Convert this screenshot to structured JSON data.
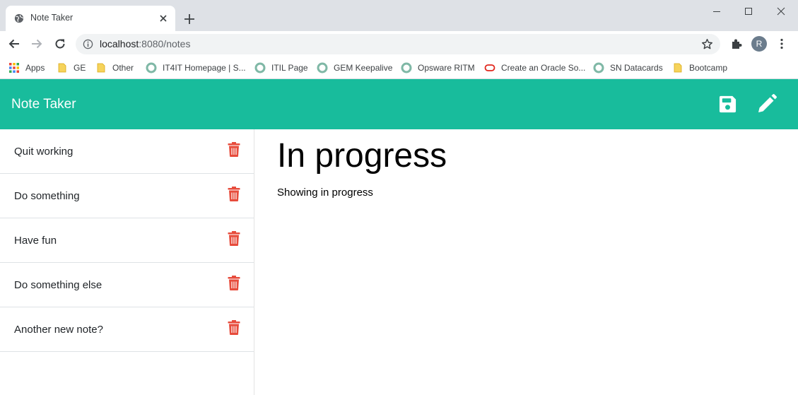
{
  "browser": {
    "tab_title": "Note Taker",
    "url_host": "localhost",
    "url_path": ":8080/notes",
    "profile_initial": "R",
    "bookmarks": [
      {
        "label": "Apps",
        "icon": "apps-grid-icon"
      },
      {
        "label": "GE",
        "icon": "folder-icon"
      },
      {
        "label": "Other",
        "icon": "folder-icon"
      },
      {
        "label": "IT4IT Homepage | S...",
        "icon": "site-icon"
      },
      {
        "label": "ITIL Page",
        "icon": "site-icon"
      },
      {
        "label": "GEM Keepalive",
        "icon": "site-icon"
      },
      {
        "label": "Opsware RITM",
        "icon": "site-icon"
      },
      {
        "label": "Create an Oracle So...",
        "icon": "oracle-icon"
      },
      {
        "label": "SN Datacards",
        "icon": "site-icon"
      },
      {
        "label": "Bootcamp",
        "icon": "folder-icon"
      }
    ]
  },
  "app": {
    "brand": "Note Taker",
    "accent_color": "#18bc9c",
    "delete_color": "#e74c3c",
    "notes": [
      {
        "title": "Quit working"
      },
      {
        "title": "Do something"
      },
      {
        "title": "Have fun"
      },
      {
        "title": "Do something else"
      },
      {
        "title": "Another new note?"
      }
    ],
    "active_note": {
      "title": "In progress",
      "text": "Showing in progress"
    }
  }
}
